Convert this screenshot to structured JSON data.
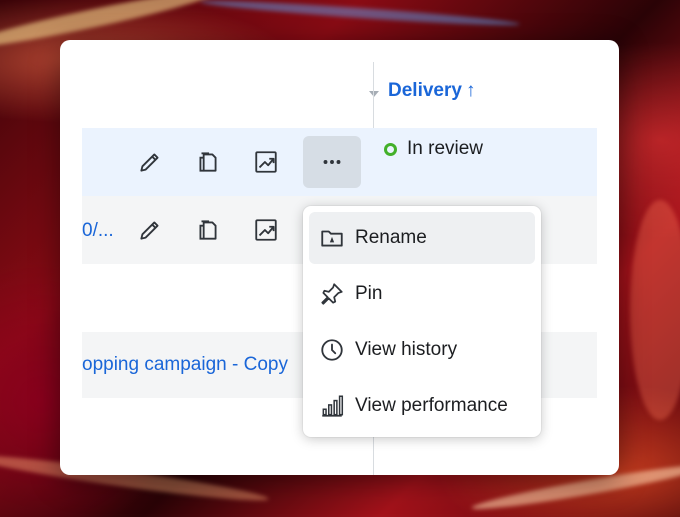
{
  "table": {
    "header": {
      "delivery_label": "Delivery",
      "sort_arrow": "↑"
    },
    "rows": [
      {
        "name_fragment": "",
        "status": "In review"
      },
      {
        "name_fragment": "0/..."
      },
      {
        "name_fragment": ""
      },
      {
        "name_fragment": "opping campaign - Copy"
      }
    ],
    "row_action_icons": [
      "pencil-icon",
      "duplicate-icon",
      "chart-trend-icon",
      "more-icon"
    ],
    "status_color": "#43b02a"
  },
  "context_menu": {
    "items": [
      {
        "label": "Rename",
        "icon": "folder-rename-icon"
      },
      {
        "label": "Pin",
        "icon": "pin-icon"
      },
      {
        "label": "View history",
        "icon": "clock-icon"
      },
      {
        "label": "View performance",
        "icon": "bar-chart-icon"
      }
    ]
  },
  "colors": {
    "accent": "#1a66d8",
    "selected_row": "#ebf3fe"
  }
}
